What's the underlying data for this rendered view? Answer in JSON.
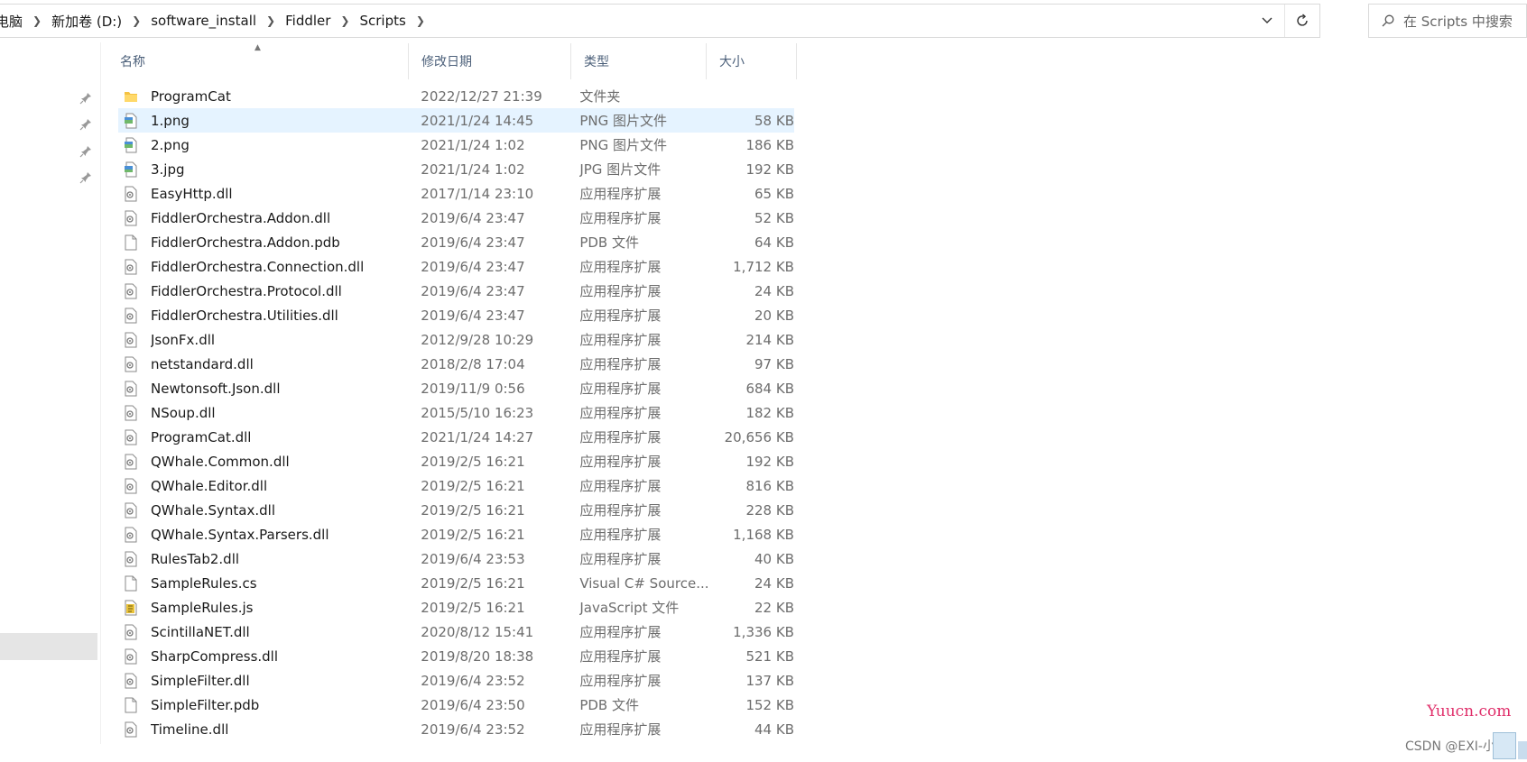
{
  "address": {
    "crumbs": [
      "电脑",
      "新加卷 (D:)",
      "software_install",
      "Fiddler",
      "Scripts"
    ],
    "dropdown_icon": "chevron-down-icon",
    "refresh_icon": "refresh-icon"
  },
  "search": {
    "placeholder": "在 Scripts 中搜索"
  },
  "columns": {
    "name": "名称",
    "date": "修改日期",
    "type": "类型",
    "size": "大小"
  },
  "files": [
    {
      "name": "ProgramCat",
      "date": "2022/12/27 21:39",
      "type": "文件夹",
      "size": "",
      "icon": "folder-icon"
    },
    {
      "name": "1.png",
      "date": "2021/1/24 14:45",
      "type": "PNG 图片文件",
      "size": "58 KB",
      "icon": "png-file-icon",
      "selected": true
    },
    {
      "name": "2.png",
      "date": "2021/1/24 1:02",
      "type": "PNG 图片文件",
      "size": "186 KB",
      "icon": "png-file-icon"
    },
    {
      "name": "3.jpg",
      "date": "2021/1/24 1:02",
      "type": "JPG 图片文件",
      "size": "192 KB",
      "icon": "jpg-file-icon"
    },
    {
      "name": "EasyHttp.dll",
      "date": "2017/1/14 23:10",
      "type": "应用程序扩展",
      "size": "65 KB",
      "icon": "dll-file-icon"
    },
    {
      "name": "FiddlerOrchestra.Addon.dll",
      "date": "2019/6/4 23:47",
      "type": "应用程序扩展",
      "size": "52 KB",
      "icon": "dll-file-icon"
    },
    {
      "name": "FiddlerOrchestra.Addon.pdb",
      "date": "2019/6/4 23:47",
      "type": "PDB 文件",
      "size": "64 KB",
      "icon": "blank-file-icon"
    },
    {
      "name": "FiddlerOrchestra.Connection.dll",
      "date": "2019/6/4 23:47",
      "type": "应用程序扩展",
      "size": "1,712 KB",
      "icon": "dll-file-icon"
    },
    {
      "name": "FiddlerOrchestra.Protocol.dll",
      "date": "2019/6/4 23:47",
      "type": "应用程序扩展",
      "size": "24 KB",
      "icon": "dll-file-icon"
    },
    {
      "name": "FiddlerOrchestra.Utilities.dll",
      "date": "2019/6/4 23:47",
      "type": "应用程序扩展",
      "size": "20 KB",
      "icon": "dll-file-icon"
    },
    {
      "name": "JsonFx.dll",
      "date": "2012/9/28 10:29",
      "type": "应用程序扩展",
      "size": "214 KB",
      "icon": "dll-file-icon"
    },
    {
      "name": "netstandard.dll",
      "date": "2018/2/8 17:04",
      "type": "应用程序扩展",
      "size": "97 KB",
      "icon": "dll-file-icon"
    },
    {
      "name": "Newtonsoft.Json.dll",
      "date": "2019/11/9 0:56",
      "type": "应用程序扩展",
      "size": "684 KB",
      "icon": "dll-file-icon"
    },
    {
      "name": "NSoup.dll",
      "date": "2015/5/10 16:23",
      "type": "应用程序扩展",
      "size": "182 KB",
      "icon": "dll-file-icon"
    },
    {
      "name": "ProgramCat.dll",
      "date": "2021/1/24 14:27",
      "type": "应用程序扩展",
      "size": "20,656 KB",
      "icon": "dll-file-icon"
    },
    {
      "name": "QWhale.Common.dll",
      "date": "2019/2/5 16:21",
      "type": "应用程序扩展",
      "size": "192 KB",
      "icon": "dll-file-icon"
    },
    {
      "name": "QWhale.Editor.dll",
      "date": "2019/2/5 16:21",
      "type": "应用程序扩展",
      "size": "816 KB",
      "icon": "dll-file-icon"
    },
    {
      "name": "QWhale.Syntax.dll",
      "date": "2019/2/5 16:21",
      "type": "应用程序扩展",
      "size": "228 KB",
      "icon": "dll-file-icon"
    },
    {
      "name": "QWhale.Syntax.Parsers.dll",
      "date": "2019/2/5 16:21",
      "type": "应用程序扩展",
      "size": "1,168 KB",
      "icon": "dll-file-icon"
    },
    {
      "name": "RulesTab2.dll",
      "date": "2019/6/4 23:53",
      "type": "应用程序扩展",
      "size": "40 KB",
      "icon": "dll-file-icon"
    },
    {
      "name": "SampleRules.cs",
      "date": "2019/2/5 16:21",
      "type": "Visual C# Source...",
      "size": "24 KB",
      "icon": "blank-file-icon"
    },
    {
      "name": "SampleRules.js",
      "date": "2019/2/5 16:21",
      "type": "JavaScript 文件",
      "size": "22 KB",
      "icon": "js-file-icon"
    },
    {
      "name": "ScintillaNET.dll",
      "date": "2020/8/12 15:41",
      "type": "应用程序扩展",
      "size": "1,336 KB",
      "icon": "dll-file-icon"
    },
    {
      "name": "SharpCompress.dll",
      "date": "2019/8/20 18:38",
      "type": "应用程序扩展",
      "size": "521 KB",
      "icon": "dll-file-icon"
    },
    {
      "name": "SimpleFilter.dll",
      "date": "2019/6/4 23:52",
      "type": "应用程序扩展",
      "size": "137 KB",
      "icon": "dll-file-icon"
    },
    {
      "name": "SimpleFilter.pdb",
      "date": "2019/6/4 23:50",
      "type": "PDB 文件",
      "size": "152 KB",
      "icon": "blank-file-icon"
    },
    {
      "name": "Timeline.dll",
      "date": "2019/6/4 23:52",
      "type": "应用程序扩展",
      "size": "44 KB",
      "icon": "dll-file-icon"
    }
  ],
  "watermarks": {
    "yuucn": "Yuucn.com",
    "csdn": "CSDN @EXI-小洲"
  },
  "colors": {
    "selected_row": "#e5f3ff",
    "header_text": "#4c607a",
    "secondary_text": "#6d6d6d",
    "folder": "#f5c242"
  }
}
